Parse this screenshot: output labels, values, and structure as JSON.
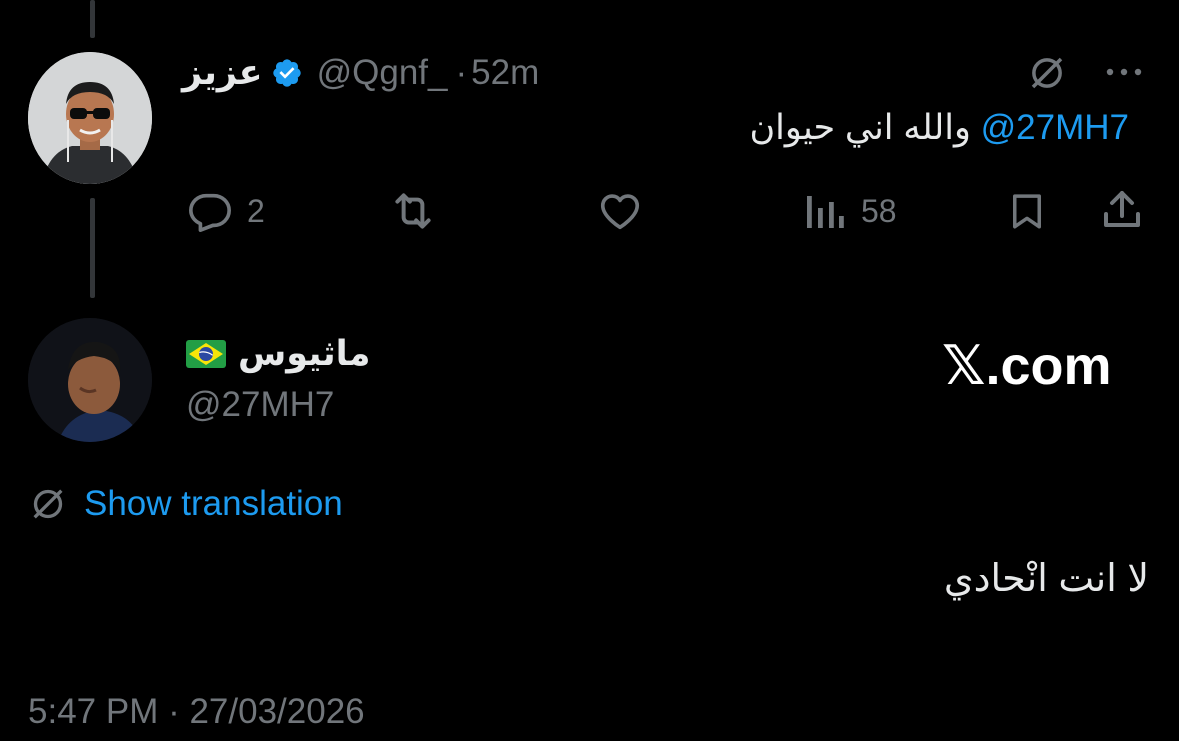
{
  "colors": {
    "background": "#000000",
    "text": "#e7e9ea",
    "muted": "#71767b",
    "accent": "#1d9bf0",
    "verified": "#1d9bf0"
  },
  "parent_tweet": {
    "author_name": "عزيز",
    "verified": true,
    "handle": "@Qgnf_",
    "separator": "·",
    "time": "52m",
    "mention": "@27MH7",
    "text": "والله اني حيوان",
    "actions": {
      "reply_icon": "reply-icon",
      "reply_count": "2",
      "retweet_icon": "retweet-icon",
      "like_icon": "heart-icon",
      "views_icon": "analytics-icon",
      "views_count": "58",
      "bookmark_icon": "bookmark-icon",
      "share_icon": "share-icon"
    },
    "top_icons": [
      "grok-icon",
      "more-icon"
    ]
  },
  "reply_tweet": {
    "author_name": "ماثيوس",
    "flag": "brazil-flag",
    "handle": "@27MH7",
    "watermark": "𝕏.com",
    "translate_label": "Show translation",
    "text": "لا انت انْحادي",
    "timestamp": "5:47 PM · 27/03/2026"
  }
}
